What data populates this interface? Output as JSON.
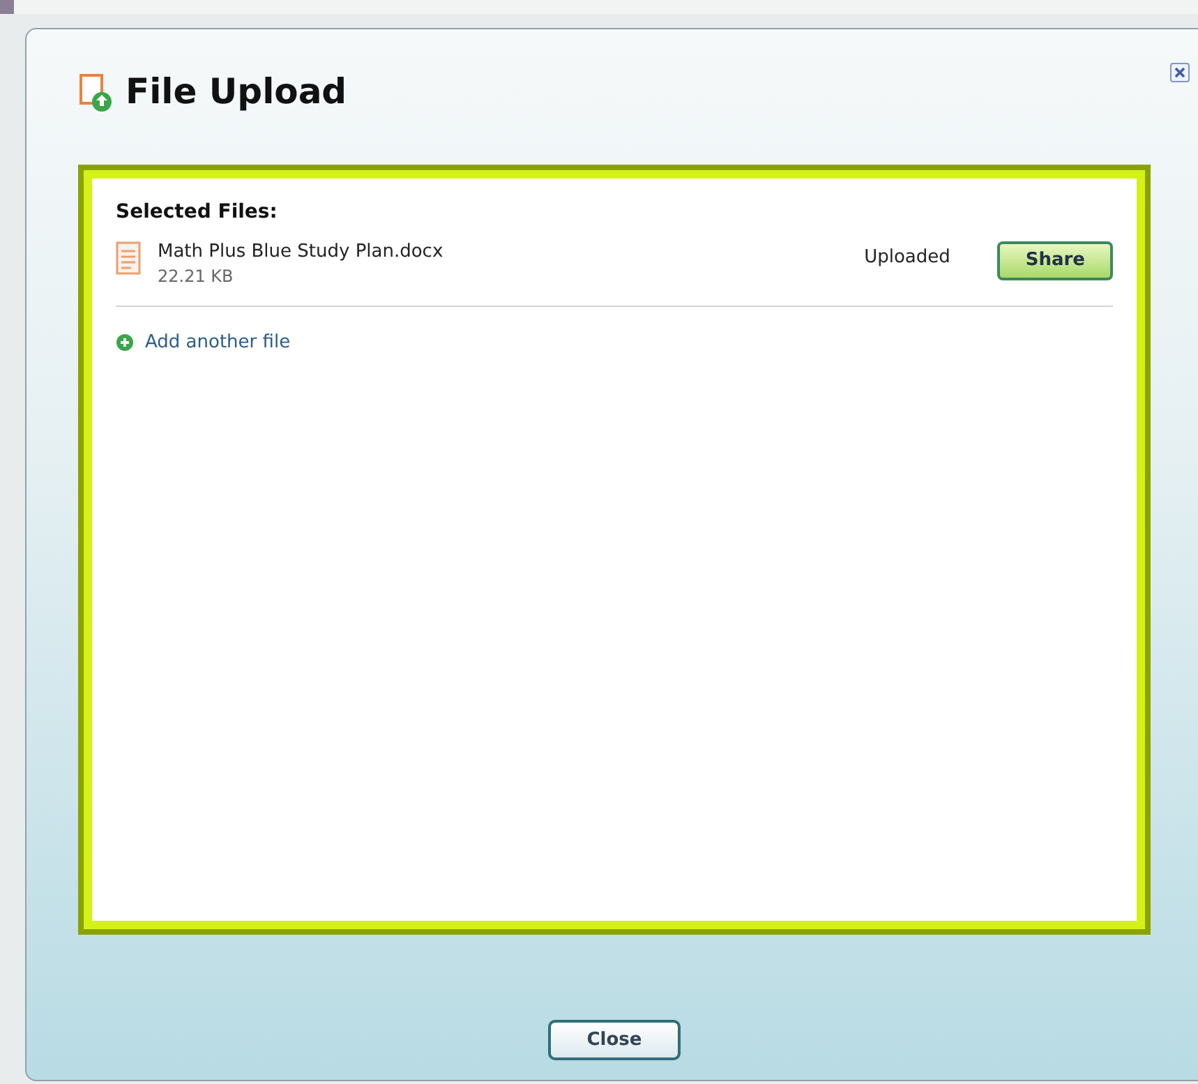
{
  "dialog": {
    "title": "File Upload"
  },
  "section_title": "Selected Files:",
  "files": [
    {
      "name": "Math Plus Blue Study Plan.docx",
      "size": "22.21 KB",
      "status": "Uploaded",
      "action": "Share"
    }
  ],
  "add_link": "Add another file",
  "buttons": [
    "Close"
  ]
}
